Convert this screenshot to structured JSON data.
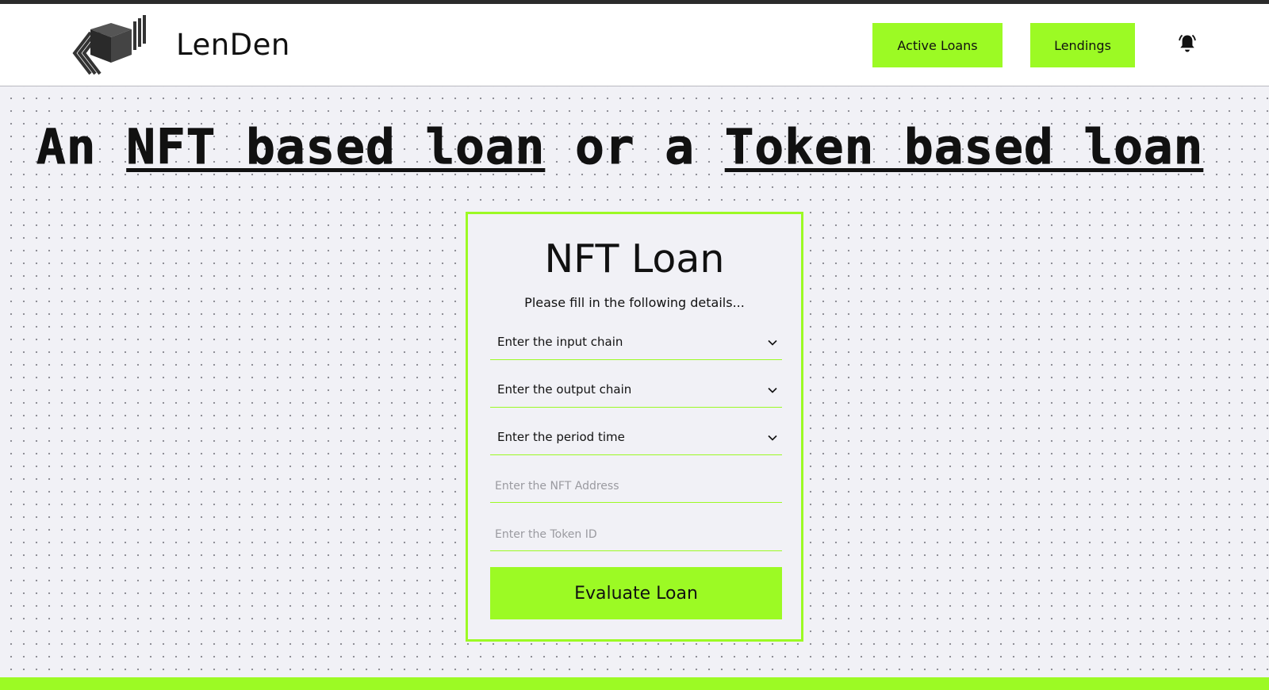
{
  "brand": {
    "name": "LenDen"
  },
  "nav": {
    "active_loans": "Active Loans",
    "lendings": "Lendings",
    "bell_icon": "bell-icon"
  },
  "headline": {
    "part1": "An ",
    "link1": "NFT based loan",
    "part2": " or a ",
    "link2": "Token based loan"
  },
  "form": {
    "title": "NFT Loan",
    "subtitle": "Please fill in the following details...",
    "input_chain": "Enter the input chain",
    "output_chain": "Enter the output chain",
    "period_time": "Enter the period time",
    "nft_address_placeholder": "Enter the NFT Address",
    "token_id_placeholder": "Enter the Token ID",
    "submit_label": "Evaluate Loan"
  },
  "colors": {
    "accent": "#9cfa24",
    "background": "#f1f1f6",
    "text": "#111111"
  }
}
